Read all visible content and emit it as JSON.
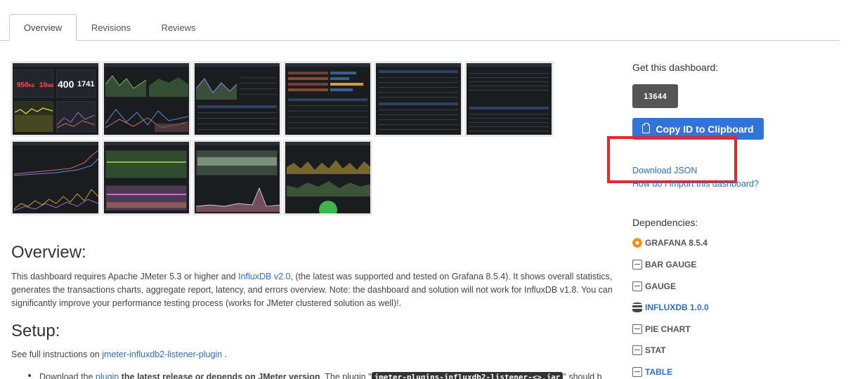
{
  "tabs": [
    {
      "label": "Overview"
    },
    {
      "label": "Revisions"
    },
    {
      "label": "Reviews"
    }
  ],
  "thumbnail_stats": {
    "s1": "958",
    "s1_unit": "KB",
    "s2": "10",
    "s2_unit": "MB",
    "s3": "400",
    "s4": "1741"
  },
  "overview": {
    "heading": "Overview:",
    "text_before_link": "This dashboard requires Apache JMeter 5.3 or higher and ",
    "link": "InfluxDB v2.0",
    "text_after_link": ", (the latest was supported and tested on Grafana 8.5.4). It shows overall statistics, generates the transactions charts, aggregate report, latency, and errors overview. Note: the dashboard and solution will not work for InfluxDB v1.8. You can significantly improve your performance testing process (works for JMeter clustered solution as well)!."
  },
  "setup": {
    "heading": "Setup:",
    "text_before_link": "See full instructions on ",
    "link": "jmeter-influxdb2-listener-plugin",
    "text_after_link": " .",
    "bullet_start": "Download the ",
    "bullet_link": "plugin",
    "bullet_bold": " the latest release or depends on JMeter version",
    "bullet_mid": ". The plugin \"",
    "bullet_code": "jmeter-plugins-influxdb2-listener-<>.jar",
    "bullet_end": "\" should be"
  },
  "sidebar": {
    "get_label": "Get this dashboard:",
    "dashboard_id": "13644",
    "copy_button": "Copy ID to Clipboard",
    "download_json": "Download JSON",
    "how_import": "How do I import this dashboard?",
    "dependencies_label": "Dependencies:",
    "dependencies": [
      {
        "label": "GRAFANA 8.5.4",
        "icon": "grafana-icon"
      },
      {
        "label": "BAR GAUGE",
        "icon": "panel-icon"
      },
      {
        "label": "GAUGE",
        "icon": "panel-icon"
      },
      {
        "label": "INFLUXDB 1.0.0",
        "icon": "database-icon"
      },
      {
        "label": "PIE CHART",
        "icon": "panel-icon"
      },
      {
        "label": "STAT",
        "icon": "panel-icon"
      },
      {
        "label": "TABLE",
        "icon": "panel-icon"
      }
    ]
  },
  "colors": {
    "accent": "#3272d9",
    "link": "#2a6fd1",
    "highlight": "#e8262d",
    "id_box": "#555555"
  }
}
